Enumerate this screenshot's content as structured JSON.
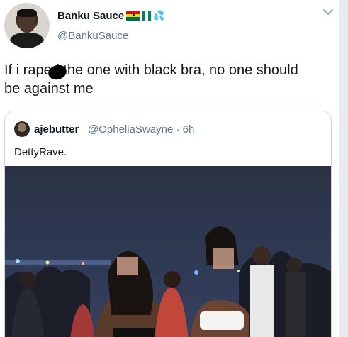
{
  "author": {
    "display_name": "Banku Sauce",
    "handle": "@BankuSauce",
    "flag_icons": [
      "ghana-flag-icon",
      "nigeria-flag-icon",
      "splash-icon"
    ]
  },
  "tweet": {
    "text": "If i raped the one with black bra, no one should be against me"
  },
  "quoted": {
    "name": "ajebutter",
    "handle": "@OpheliaSwayne",
    "separator": "·",
    "time": "6h",
    "text": "DettyRave."
  },
  "colors": {
    "text_primary": "#14171a",
    "text_secondary": "#657786",
    "border": "#ccd6dd",
    "page_bg": "#e6ecf0"
  }
}
